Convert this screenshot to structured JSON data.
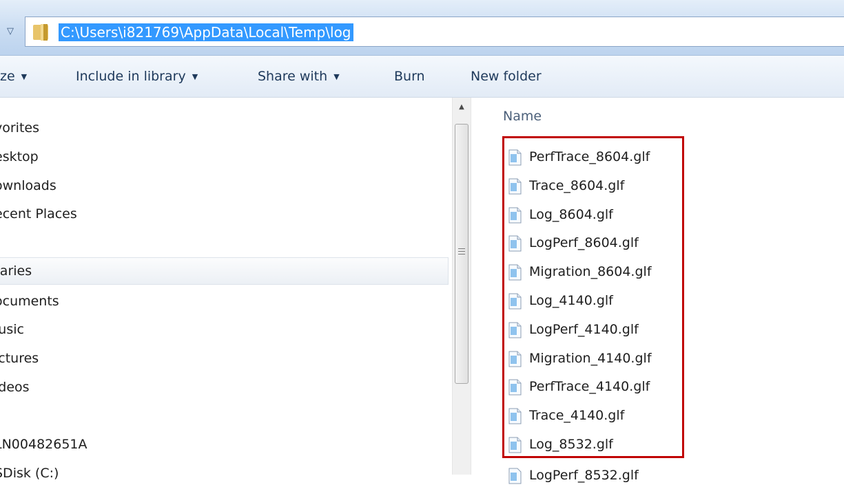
{
  "address_bar": {
    "path": "C:\\Users\\i821769\\AppData\\Local\\Temp\\log"
  },
  "toolbar": {
    "organize_label": "ze",
    "include_in_library_label": "Include in library",
    "share_with_label": "Share with",
    "burn_label": "Burn",
    "new_folder_label": "New folder"
  },
  "nav": {
    "items": [
      "vorites",
      "esktop",
      "ownloads",
      "ecent Places",
      "raries",
      "ocuments",
      "lusic",
      "ictures",
      "ideos",
      "LN00482651A",
      "SDisk (C:)"
    ]
  },
  "content": {
    "column_header": "Name",
    "files": [
      "PerfTrace_8604.glf",
      "Trace_8604.glf",
      "Log_8604.glf",
      "LogPerf_8604.glf",
      "Migration_8604.glf",
      "Log_4140.glf",
      "LogPerf_4140.glf",
      "Migration_4140.glf",
      "PerfTrace_4140.glf",
      "Trace_4140.glf",
      "Log_8532.glf"
    ],
    "partial_file": "LogPerf_8532.glf"
  },
  "colors": {
    "selection": "#3399ff",
    "highlight_box": "#c00000",
    "toolbar_text": "#1e395b"
  },
  "icons": {
    "address_folder": "folder-icon",
    "file": "glf-file-icon",
    "back": "chevron-down-icon"
  }
}
